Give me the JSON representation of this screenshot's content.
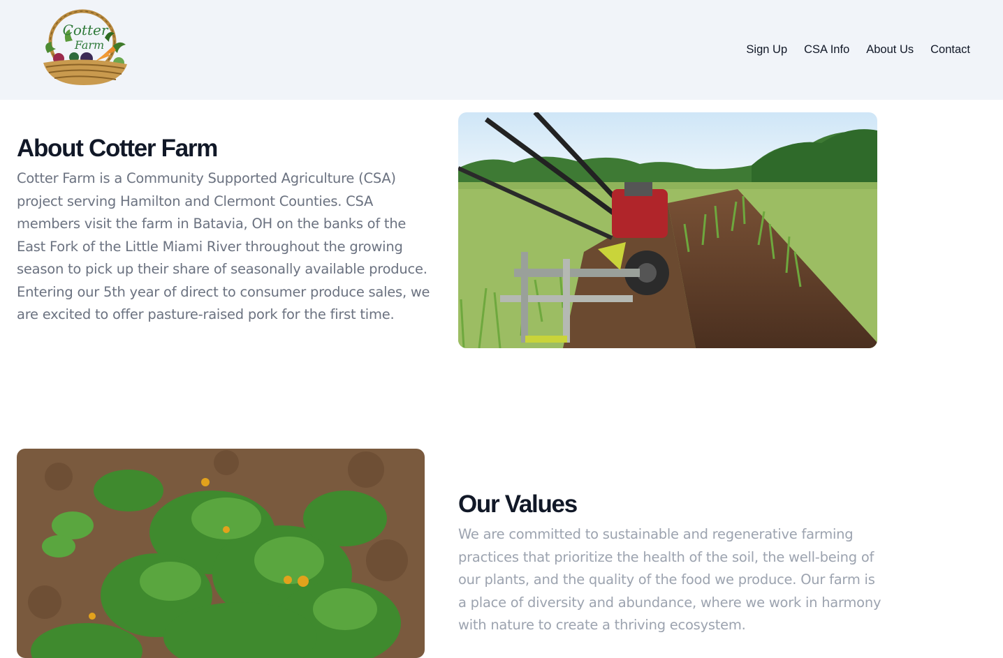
{
  "header": {
    "logo": {
      "text_line1": "Cotter",
      "text_line2": "Farm",
      "icon": "basket-logo"
    },
    "nav": [
      {
        "label": "Sign Up"
      },
      {
        "label": "CSA Info"
      },
      {
        "label": "About Us"
      },
      {
        "label": "Contact"
      }
    ]
  },
  "about": {
    "title": "About Cotter Farm",
    "body": "Cotter Farm is a Community Supported Agriculture (CSA) project serving Hamilton and Clermont Counties. CSA members visit the farm in Batavia, OH on the banks of the East Fork of the Little Miami River throughout the growing season to pick up their share of seasonally available produce. Entering our 5th year of direct to consumer produce sales, we are excited to offer pasture-raised pork for the first time.",
    "image": "tractor-in-garlic-field-photo"
  },
  "values": {
    "title": "Our Values",
    "body": "We are committed to sustainable and regenerative farming practices that prioritize the health of the soil, the well-being of our plants, and the quality of the food we produce. Our farm is a place of diversity and abundance, where we work in harmony with nature to create a thriving ecosystem.",
    "image": "zucchini-plants-photo"
  },
  "colors": {
    "header_bg": "#f1f4f9",
    "heading": "#111827",
    "body_text": "#6b7280",
    "muted_text": "#9ca3af"
  }
}
